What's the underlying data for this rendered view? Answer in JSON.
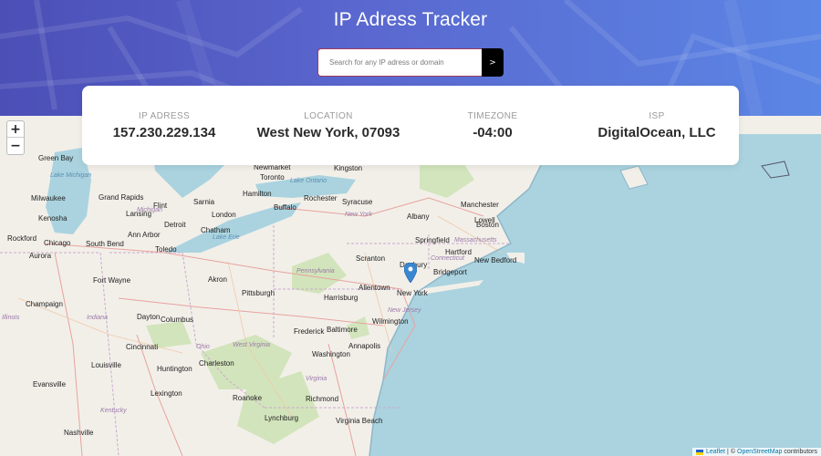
{
  "header": {
    "title": "IP Adress Tracker"
  },
  "search": {
    "placeholder": "Search for any IP adress or domain",
    "value": "",
    "button_label": ">"
  },
  "info": {
    "ip": {
      "label": "IP ADRESS",
      "value": "157.230.229.134"
    },
    "location": {
      "label": "LOCATION",
      "value": "West New York, 07093"
    },
    "timezone": {
      "label": "TIMEZONE",
      "value": "-04:00"
    },
    "isp": {
      "label": "ISP",
      "value": "DigitalOcean, LLC"
    }
  },
  "map": {
    "zoom_in": "+",
    "zoom_out": "−",
    "marker_icon": "map-pin-icon",
    "cities": [
      {
        "name": "Green Bay"
      },
      {
        "name": "Milwaukee"
      },
      {
        "name": "Kenosha"
      },
      {
        "name": "Rockford"
      },
      {
        "name": "Chicago"
      },
      {
        "name": "Aurora"
      },
      {
        "name": "Grand Rapids"
      },
      {
        "name": "Lansing"
      },
      {
        "name": "Flint"
      },
      {
        "name": "Detroit"
      },
      {
        "name": "Ann Arbor"
      },
      {
        "name": "Toledo"
      },
      {
        "name": "South Bend"
      },
      {
        "name": "Fort Wayne"
      },
      {
        "name": "Champaign"
      },
      {
        "name": "Dayton"
      },
      {
        "name": "Columbus"
      },
      {
        "name": "Cincinnati"
      },
      {
        "name": "Louisville"
      },
      {
        "name": "Evansville"
      },
      {
        "name": "Lexington"
      },
      {
        "name": "Nashville"
      },
      {
        "name": "London"
      },
      {
        "name": "Sarnia"
      },
      {
        "name": "Chatham"
      },
      {
        "name": "Hamilton"
      },
      {
        "name": "Toronto"
      },
      {
        "name": "Newmarket"
      },
      {
        "name": "Kingston"
      },
      {
        "name": "Rochester"
      },
      {
        "name": "Buffalo"
      },
      {
        "name": "Syracuse"
      },
      {
        "name": "Albany"
      },
      {
        "name": "Manchester"
      },
      {
        "name": "Lowell"
      },
      {
        "name": "Boston"
      },
      {
        "name": "Springfield"
      },
      {
        "name": "Hartford"
      },
      {
        "name": "New Bedford"
      },
      {
        "name": "Danbury"
      },
      {
        "name": "Bridgeport"
      },
      {
        "name": "Scranton"
      },
      {
        "name": "Allentown"
      },
      {
        "name": "New York"
      },
      {
        "name": "Akron"
      },
      {
        "name": "Pittsburgh"
      },
      {
        "name": "Harrisburg"
      },
      {
        "name": "Wilmington"
      },
      {
        "name": "Frederick"
      },
      {
        "name": "Baltimore"
      },
      {
        "name": "Washington"
      },
      {
        "name": "Annapolis"
      },
      {
        "name": "Charleston"
      },
      {
        "name": "Roanoke"
      },
      {
        "name": "Richmond"
      },
      {
        "name": "Virginia Beach"
      },
      {
        "name": "Lynchburg"
      },
      {
        "name": "Huntington"
      }
    ],
    "regions": [
      {
        "name": "Lake Michigan"
      },
      {
        "name": "Michigan"
      },
      {
        "name": "Ohio"
      },
      {
        "name": "Indiana"
      },
      {
        "name": "Illinois"
      },
      {
        "name": "Kentucky"
      },
      {
        "name": "Pennsylvania"
      },
      {
        "name": "New York"
      },
      {
        "name": "West Virginia"
      },
      {
        "name": "Virginia"
      },
      {
        "name": "Connecticut"
      },
      {
        "name": "Massachusetts"
      },
      {
        "name": "New Jersey"
      },
      {
        "name": "Lake Erie"
      },
      {
        "name": "Lake Ontario"
      }
    ]
  },
  "attribution": {
    "leaflet": "Leaflet",
    "separator": "|",
    "copyright": "©",
    "osm": "OpenStreetMap",
    "contributors": "contributors"
  }
}
